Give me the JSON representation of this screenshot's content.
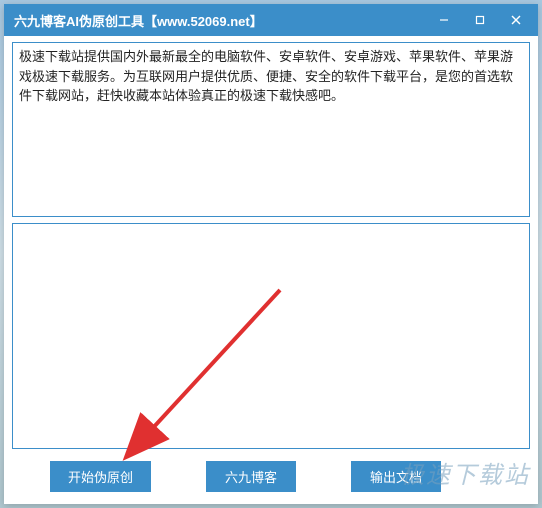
{
  "window": {
    "title": "六九博客AI伪原创工具【www.52069.net】"
  },
  "input_text": "极速下载站提供国内外最新最全的电脑软件、安卓软件、安卓游戏、苹果软件、苹果游戏极速下载服务。为互联网用户提供优质、便捷、安全的软件下载平台，是您的首选软件下载网站，赶快收藏本站体验真正的极速下载快感吧。",
  "output_text": "",
  "buttons": {
    "start": "开始伪原创",
    "blog": "六九博客",
    "export": "输出文档"
  },
  "watermark": "极速下载站"
}
